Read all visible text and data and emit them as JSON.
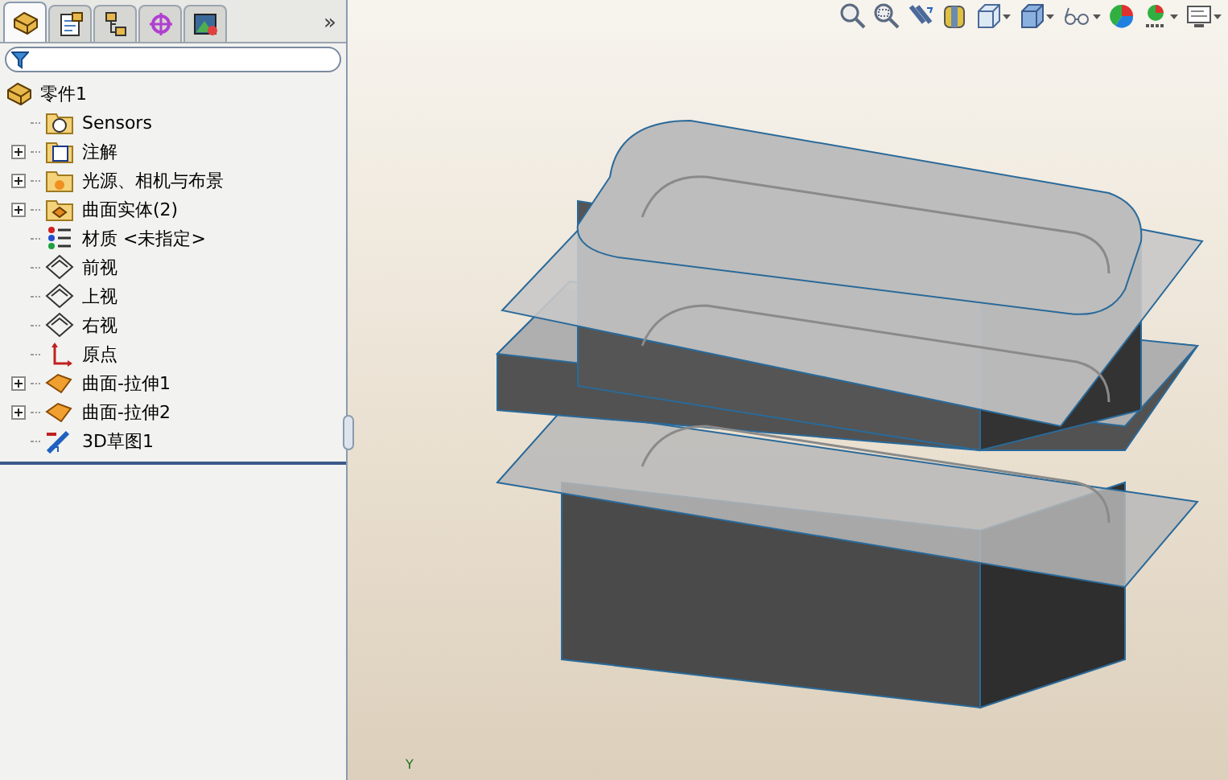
{
  "panel_tabs": [
    {
      "kind": "feature-tree",
      "selected": true
    },
    {
      "kind": "property",
      "selected": false
    },
    {
      "kind": "configuration",
      "selected": false
    },
    {
      "kind": "dimxpert",
      "selected": false
    },
    {
      "kind": "display",
      "selected": false
    }
  ],
  "panel_more": "»",
  "tree": {
    "label": "零件1",
    "kind": "part",
    "children": [
      {
        "label": "Sensors",
        "kind": "sensor-folder",
        "expandable": false
      },
      {
        "label": "注解",
        "kind": "annotation-folder",
        "expandable": true
      },
      {
        "label": "光源、相机与布景",
        "kind": "light-folder",
        "expandable": true
      },
      {
        "label": "曲面实体(2)",
        "kind": "surface-folder",
        "expandable": true
      },
      {
        "label": "材质 <未指定>",
        "kind": "material",
        "expandable": false
      },
      {
        "label": "前视",
        "kind": "plane",
        "expandable": false
      },
      {
        "label": "上视",
        "kind": "plane",
        "expandable": false
      },
      {
        "label": "右视",
        "kind": "plane",
        "expandable": false
      },
      {
        "label": "原点",
        "kind": "origin",
        "expandable": false
      },
      {
        "label": "曲面-拉伸1",
        "kind": "extrude",
        "expandable": true
      },
      {
        "label": "曲面-拉伸2",
        "kind": "extrude",
        "expandable": true
      },
      {
        "label": "3D草图1",
        "kind": "sketch",
        "expandable": false
      }
    ]
  },
  "view_toolbar": [
    {
      "kind": "zoom-fit",
      "dropdown": false
    },
    {
      "kind": "zoom-area",
      "dropdown": false
    },
    {
      "kind": "previous-view",
      "dropdown": false
    },
    {
      "kind": "section-view",
      "dropdown": false
    },
    {
      "kind": "view-orientation",
      "dropdown": true
    },
    {
      "kind": "display-style",
      "dropdown": true
    },
    {
      "kind": "hide-show",
      "dropdown": true
    },
    {
      "kind": "appearance",
      "dropdown": false
    },
    {
      "kind": "scene",
      "dropdown": true
    },
    {
      "kind": "view-settings",
      "dropdown": true
    }
  ],
  "triad_label": "Y"
}
